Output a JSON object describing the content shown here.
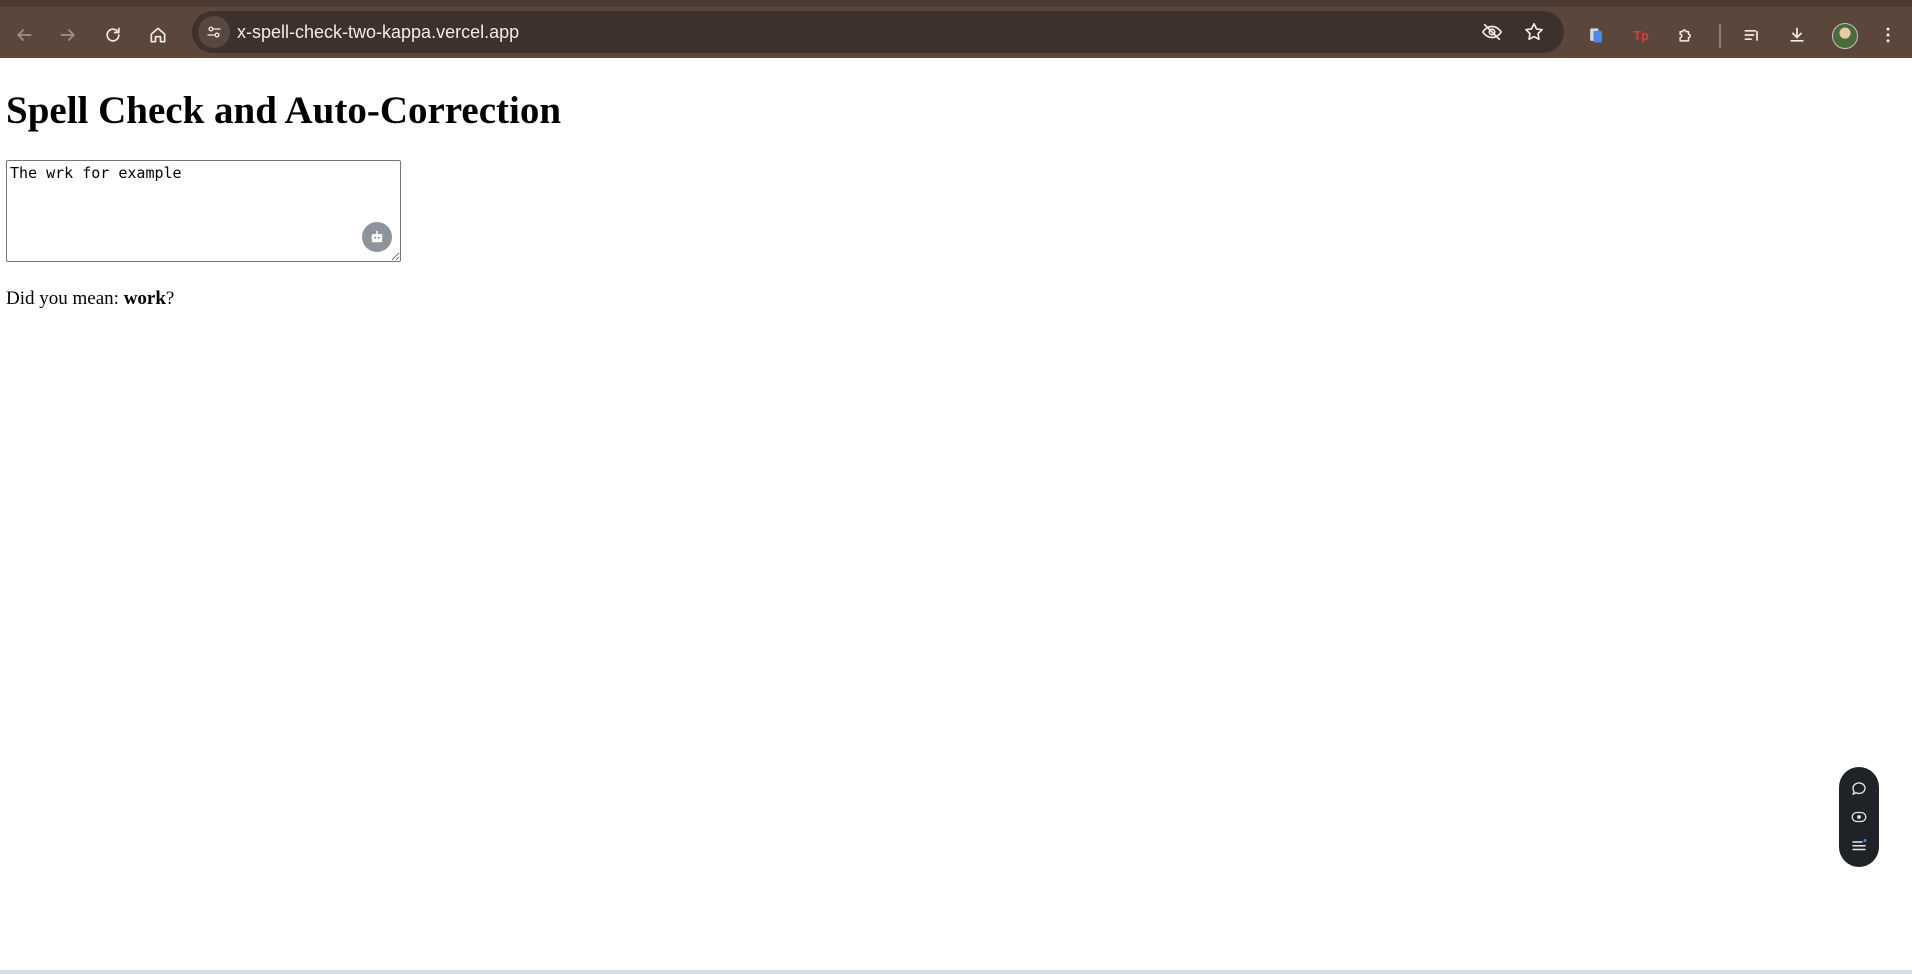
{
  "browser": {
    "url": "x-spell-check-two-kappa.vercel.app",
    "icons": {
      "back": "back-arrow-icon",
      "forward": "forward-arrow-icon",
      "reload": "reload-icon",
      "home": "home-icon",
      "site_info": "site-settings-icon",
      "tracking": "eye-off-icon",
      "bookmark": "star-icon",
      "extension_1": "docs-extension-icon",
      "extension_2": "tp-extension-icon",
      "extensions": "puzzle-icon",
      "reading_list": "reading-list-icon",
      "downloads": "download-icon",
      "menu": "kebab-menu-icon"
    },
    "colors": {
      "toolbar": "#5b463b",
      "omnibox": "#3e302a",
      "text": "#f2ece8"
    }
  },
  "page": {
    "title": "Spell Check and Auto-Correction",
    "textarea_value": "The wrk for example",
    "suggestion_prefix": "Did you mean: ",
    "suggestion_word": "work",
    "suggestion_suffix": "?"
  },
  "floating_panel": {
    "icons": [
      "chat-icon",
      "screen-record-icon",
      "list-icon"
    ]
  }
}
